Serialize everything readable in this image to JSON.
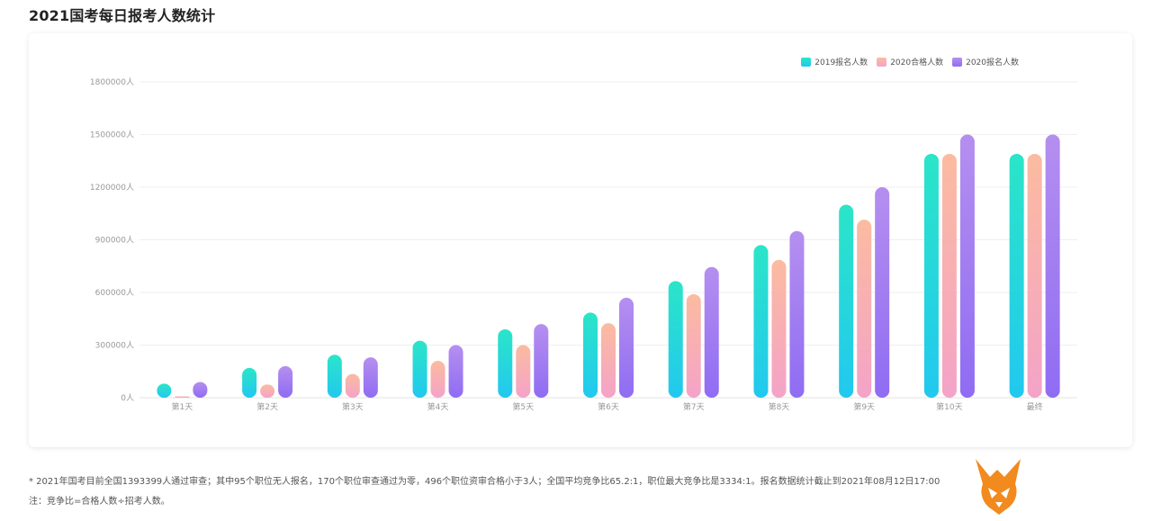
{
  "page": {
    "title": "2021国考每日报考人数统计",
    "note_1": "* 2021年国考目前全国1393399人通过审查；其中95个职位无人报名，170个职位审查通过为零，496个职位资审合格小于3人；全国平均竞争比65.2:1，职位最大竞争比是3334:1。报名数据统计截止到2021年08月12日17:00",
    "note_2": "注：竞争比=合格人数÷招考人数。"
  },
  "legend": [
    {
      "name": "2019报名人数",
      "color_top": "#2be5c8",
      "color_bottom": "#22c8ef"
    },
    {
      "name": "2020合格人数",
      "color_top": "#fbbba0",
      "color_bottom": "#f4a3c8"
    },
    {
      "name": "2020报名人数",
      "color_top": "#b58fef",
      "color_bottom": "#8f6cf3"
    }
  ],
  "chart_data": {
    "type": "bar",
    "title": "2021国考每日报考人数统计",
    "categories": [
      "第1天",
      "第2天",
      "第3天",
      "第4天",
      "第5天",
      "第6天",
      "第7天",
      "第8天",
      "第9天",
      "第10天",
      "最终"
    ],
    "series": [
      {
        "name": "2019报名人数",
        "values": [
          80000,
          170000,
          245000,
          325000,
          390000,
          485000,
          665000,
          870000,
          1100000,
          1390000,
          1390000
        ]
      },
      {
        "name": "2020合格人数",
        "values": [
          8000,
          75000,
          135000,
          210000,
          300000,
          425000,
          590000,
          785000,
          1015000,
          1390000,
          1390000
        ]
      },
      {
        "name": "2020报名人数",
        "values": [
          90000,
          180000,
          230000,
          300000,
          420000,
          570000,
          745000,
          950000,
          1200000,
          1500000,
          1500000
        ]
      }
    ],
    "yticks": [
      "0人",
      "300000人",
      "600000人",
      "900000人",
      "1200000人",
      "1500000人",
      "1800000人"
    ],
    "ylim": [
      0,
      1800000
    ],
    "grid": true,
    "legend_position": "top-right"
  }
}
